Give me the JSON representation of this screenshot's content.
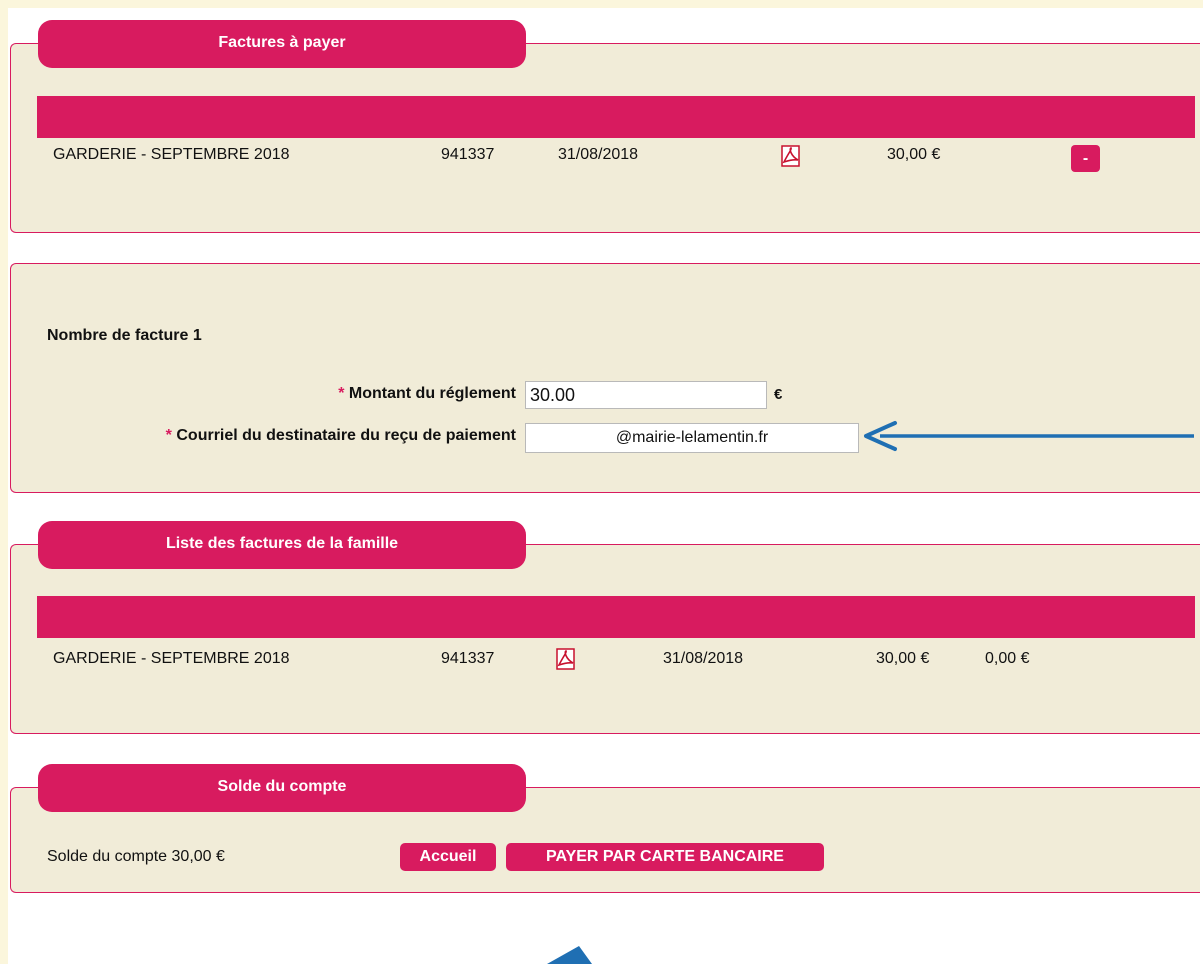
{
  "factures_a_payer": {
    "title": "Factures à payer",
    "row": {
      "label": "GARDERIE - SEPTEMBRE 2018",
      "number": "941337",
      "date": "31/08/2018",
      "amount": "30,00 €",
      "remove_label": "-"
    }
  },
  "reglement": {
    "count_text": "Nombre de facture 1",
    "required_mark": "*",
    "montant_label": "Montant du réglement",
    "montant_value": "30.00",
    "currency": "€",
    "courriel_label": "Courriel du destinataire du reçu de paiement",
    "courriel_value": "@mairie-lelamentin.fr"
  },
  "liste_factures": {
    "title": "Liste des factures de la famille",
    "row": {
      "label": "GARDERIE - SEPTEMBRE 2018",
      "number": "941337",
      "date": "31/08/2018",
      "amount": "30,00 €",
      "remaining": "0,00 €"
    }
  },
  "solde": {
    "title": "Solde du compte",
    "text": "Solde du compte 30,00 €"
  },
  "buttons": {
    "accueil": "Accueil",
    "payer": "PAYER PAR CARTE BANCAIRE"
  },
  "colors": {
    "accent": "#d81b5f",
    "panel": "#f1ecd8",
    "background": "#fbf6dc",
    "annotation_arrow": "#1f6fb3"
  },
  "icons": [
    "pdf-icon",
    "arrow-annotation-icon"
  ]
}
